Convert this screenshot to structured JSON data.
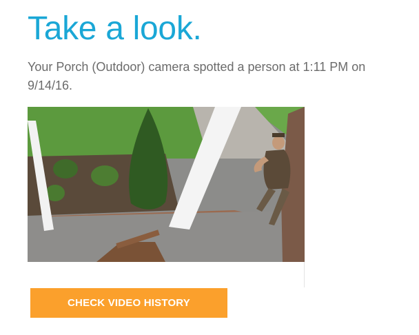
{
  "email": {
    "headline": "Take a look.",
    "message": "Your Porch (Outdoor) camera spotted a person at 1:11 PM on 9/14/16.",
    "snapshot": {
      "content": "porch-camera-snapshot-person"
    },
    "cta": {
      "label": "CHECK VIDEO HISTORY",
      "color": "#fba02c"
    }
  },
  "colors": {
    "headline": "#1aa7d6",
    "body_text": "#6b6b6b",
    "background": "#ffffff"
  }
}
